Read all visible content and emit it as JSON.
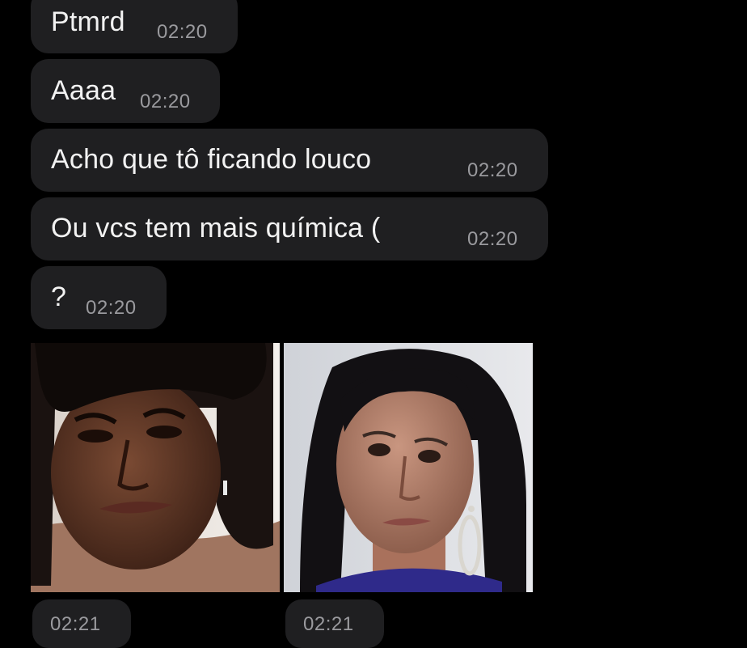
{
  "messages": [
    {
      "text": "Ptmrd",
      "time": "02:20"
    },
    {
      "text": "Aaaa",
      "time": "02:20"
    },
    {
      "text": "Acho que tô ficando louco",
      "time": "02:20"
    },
    {
      "text": "Ou vcs tem mais química (",
      "time": "02:20"
    },
    {
      "text": "?",
      "time": "02:20"
    }
  ],
  "media": [
    {
      "icon": "photo-dark-hair-person",
      "time": "02:21"
    },
    {
      "icon": "photo-woman-hoop-earring",
      "time": "02:21"
    }
  ],
  "colors": {
    "background": "#000000",
    "bubble": "#1f1f21",
    "text": "#f2f2f2",
    "timestamp": "#9a9a9e"
  }
}
